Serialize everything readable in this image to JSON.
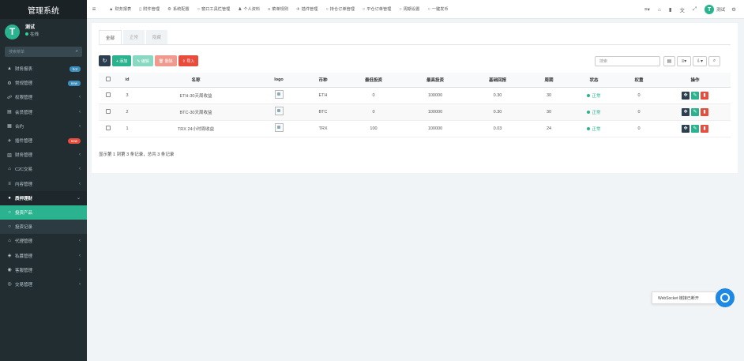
{
  "app": {
    "title": "管理系统"
  },
  "user": {
    "name": "测试",
    "status": "在线",
    "avatar": "T"
  },
  "sidebar": {
    "search_placeholder": "搜索菜单",
    "items": [
      {
        "label": "财务报表",
        "icon": "line-chart-icon",
        "glyph": "▲",
        "badge": "hot"
      },
      {
        "label": "常规管理",
        "icon": "cogs-icon",
        "glyph": "⚙",
        "badge": "new"
      },
      {
        "label": "权限管理",
        "icon": "group-icon",
        "glyph": "☍"
      },
      {
        "label": "会员管理",
        "icon": "list-icon",
        "glyph": "▤"
      },
      {
        "label": "合约",
        "icon": "calendar-icon",
        "glyph": "▦"
      },
      {
        "label": "插件管理",
        "icon": "rocket-icon",
        "glyph": "✈",
        "badge": "new"
      },
      {
        "label": "财务管理",
        "icon": "list-alt-icon",
        "glyph": "▥"
      },
      {
        "label": "C2C交易",
        "icon": "bank-icon",
        "glyph": "⌂"
      },
      {
        "label": "内容管理",
        "icon": "file-text-icon",
        "glyph": "≡"
      },
      {
        "label": "质押理财",
        "icon": "circle-icon",
        "glyph": "●"
      },
      {
        "label": "投资产品",
        "icon": "circle-o-icon",
        "glyph": "○"
      },
      {
        "label": "投资记录",
        "icon": "circle-o-icon",
        "glyph": "○"
      },
      {
        "label": "代理管理",
        "icon": "home-icon",
        "glyph": "⌂"
      },
      {
        "label": "私募管理",
        "icon": "cube-icon",
        "glyph": "◈"
      },
      {
        "label": "客服管理",
        "icon": "comment-icon",
        "glyph": "◉"
      },
      {
        "label": "交易管理",
        "icon": "eye-icon",
        "glyph": "◎"
      }
    ]
  },
  "topbar": {
    "items": [
      {
        "label": "财务报表",
        "glyph": "▲"
      },
      {
        "label": "附件管理",
        "glyph": "▯"
      },
      {
        "label": "系统配置",
        "glyph": "⚙"
      },
      {
        "label": "窗口工具栏管理",
        "glyph": "○"
      },
      {
        "label": "个人资料",
        "glyph": "♟"
      },
      {
        "label": "菜单规则",
        "glyph": "≡"
      },
      {
        "label": "插件管理",
        "glyph": "✈"
      },
      {
        "label": "持仓订单管理",
        "glyph": "○"
      },
      {
        "label": "平仓订单管理",
        "glyph": "○"
      },
      {
        "label": "周期设置",
        "glyph": "○"
      },
      {
        "label": "一键发币",
        "glyph": "○"
      }
    ],
    "right_user": "测试"
  },
  "main": {
    "tabs": [
      "全部",
      "正常",
      "隐藏"
    ],
    "toolbar": {
      "add": "+ 添加",
      "edit": "✎ 编辑",
      "delete": "🗑 删除",
      "import": "⇪ 导入"
    },
    "search_placeholder": "搜索",
    "columns": [
      "id",
      "名称",
      "logo",
      "币种",
      "最低投资",
      "最高投资",
      "基础回报",
      "周期",
      "状态",
      "权重",
      "操作"
    ],
    "rows": [
      {
        "id": "3",
        "name": "ETH-30天周收益",
        "coin": "ETH",
        "min": "0",
        "max": "100000",
        "rate": "0.30",
        "period": "30",
        "status": "正常",
        "weight": "0"
      },
      {
        "id": "2",
        "name": "BTC-30天周收益",
        "coin": "BTC",
        "min": "0",
        "max": "100000",
        "rate": "0.30",
        "period": "30",
        "status": "正常",
        "weight": "0"
      },
      {
        "id": "1",
        "name": "TRX 24小时周收益",
        "coin": "TRX",
        "min": "100",
        "max": "100000",
        "rate": "0.03",
        "period": "24",
        "status": "正常",
        "weight": "0"
      }
    ],
    "pager_info": "显示第 1 到第 3 条记录，总共 3 条记录"
  },
  "toast": {
    "text": "WebSocket 链接已断开"
  },
  "colors": {
    "brand": "#2bb28e",
    "sidebar": "#222d32",
    "danger": "#e74c3c",
    "dark": "#2c3e50"
  }
}
